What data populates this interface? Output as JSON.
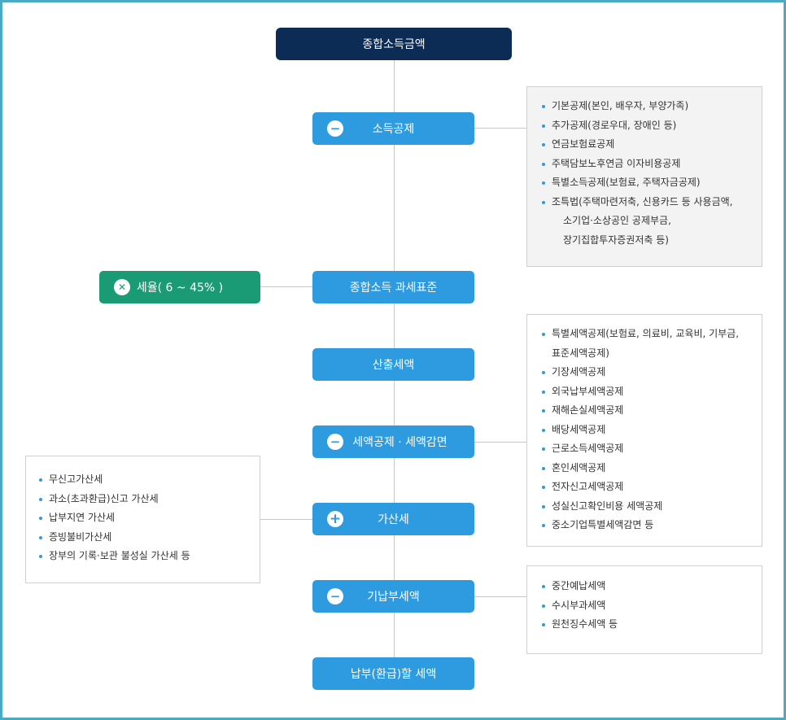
{
  "nodes": {
    "total_income": "종합소득금액",
    "income_deduction": "소득공제",
    "tax_rate": "세율( 6 ~ 45% )",
    "tax_base": "종합소득 과세표준",
    "computed_tax": "산출세액",
    "tax_credit": "세액공제 · 세액감면",
    "additional_tax": "가산세",
    "prepaid_tax": "기납부세액",
    "final_tax": "납부(환급)할 세액"
  },
  "icons": {
    "minus": "−",
    "times": "✕",
    "plus": "+"
  },
  "panels": {
    "income_deduction_items": [
      "기본공제(본인, 배우자, 부양가족)",
      "추가공제(경로우대, 장애인 등)",
      "연금보험료공제",
      "주택담보노후연금 이자비용공제",
      "특별소득공제(보험료, 주택자금공제)",
      "조특법(주택마련저축, 신용카드 등 사용금액,",
      "소기업·소상공인 공제부금,",
      "장기집합투자증권저축 등)"
    ],
    "tax_credit_items": [
      "특별세액공제(보험료, 의료비, 교육비, 기부금,",
      "표준세액공제)",
      "기장세액공제",
      "외국납부세액공제",
      "재해손실세액공제",
      "배당세액공제",
      "근로소득세액공제",
      "혼인세액공제",
      "전자신고세액공제",
      "성실신고확인비용 세액공제",
      "중소기업특별세액감면 등"
    ],
    "additional_tax_items": [
      "무신고가산세",
      "과소(초과환급)신고 가산세",
      "납부지연 가산세",
      "증빙불비가산세",
      "장부의 기록·보관 불성실 가산세 등"
    ],
    "prepaid_tax_items": [
      "중간예납세액",
      "수시부과세액",
      "원천징수세액 등"
    ]
  },
  "colors": {
    "navy": "#0d2c55",
    "blue": "#2e9be0",
    "green": "#1a9b75",
    "frame": "#4aa9c3"
  }
}
